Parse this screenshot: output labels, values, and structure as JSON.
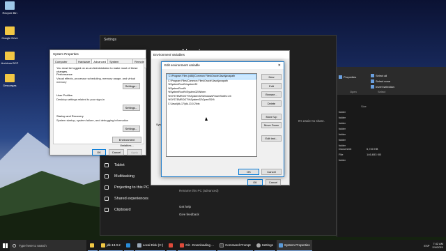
{
  "desktop": {
    "icons": [
      {
        "label": "Recycle Bin",
        "color": "#9ec7e8"
      },
      {
        "label": "Google Drive",
        "color": "#f2c744"
      },
      {
        "label": "Archivos BCP",
        "color": "#f2c744"
      },
      {
        "label": "Descargas",
        "color": "#f2c744"
      }
    ]
  },
  "settings": {
    "title": "Settings",
    "heading": "About",
    "side_note": "It's easier to share.",
    "nav": [
      {
        "label": "Tablet",
        "icon": "tablet-icon"
      },
      {
        "label": "Multitasking",
        "icon": "multitasking-icon"
      },
      {
        "label": "Projecting to this PC",
        "icon": "projecting-icon"
      },
      {
        "label": "Shared experiences",
        "icon": "shared-icon"
      },
      {
        "label": "Clipboard",
        "icon": "clipboard-icon"
      }
    ],
    "rename": "Rename this PC (advanced)",
    "help": "Get help",
    "feedback": "Give feedback"
  },
  "explorer": {
    "ribbon": {
      "properties": "Properties",
      "open": "Open",
      "select_all": "Select all",
      "select_none": "Select none",
      "invert": "Invert selection",
      "group_open": "Open",
      "group_select": "Select"
    },
    "size_header": "Size",
    "rows": [
      {
        "type": "folder",
        "size": ""
      },
      {
        "type": "folder",
        "size": ""
      },
      {
        "type": "folder",
        "size": ""
      },
      {
        "type": "folder",
        "size": ""
      },
      {
        "type": "folder",
        "size": ""
      },
      {
        "type": "folder",
        "size": ""
      },
      {
        "type": "folder",
        "size": ""
      },
      {
        "type": "Document",
        "size": "6,740 KB"
      },
      {
        "type": "File",
        "size": "146,653 KB"
      },
      {
        "type": "folder",
        "size": ""
      }
    ]
  },
  "sysprop": {
    "title": "System Properties",
    "tabs": [
      "Computer Name",
      "Hardware",
      "Advanced",
      "System Protection",
      "Remote"
    ],
    "active_tab": "Advanced",
    "note": "You must be logged on as an Administrator to make most of these changes.",
    "sections": [
      {
        "heading": "Performance",
        "desc": "Visual effects, processor scheduling, memory usage, and virtual memory",
        "button": "Settings..."
      },
      {
        "heading": "User Profiles",
        "desc": "Desktop settings related to your sign-in",
        "button": "Settings..."
      },
      {
        "heading": "Startup and Recovery",
        "desc": "System startup, system failure, and debugging information",
        "button": "Settings..."
      }
    ],
    "env_button": "Environment Variables...",
    "ok": "OK",
    "cancel": "Cancel",
    "apply": "Apply"
  },
  "envvars": {
    "title": "Environment Variables",
    "frag_a": "Syst",
    "ok": "OK",
    "cancel": "Cancel"
  },
  "editenv": {
    "title": "Edit environment variable",
    "close": "✕",
    "items": [
      "C:\\Program Files (x86)\\Common Files\\Oracle\\Java\\javapath",
      "C:\\Program Files\\Common Files\\Oracle\\Java\\javapath",
      "%SystemRoot%\\system32",
      "%SystemRoot%",
      "%SystemRoot%\\System32\\Wbem",
      "%SYSTEMROOT%\\System32\\WindowsPowerShell\\v1.0\\",
      "%SYSTEMROOT%\\System32\\OpenSSH\\",
      "C:\\Java\\jdk-17\\jdk-13.0.2\\bin"
    ],
    "buttons": [
      "New",
      "Edit",
      "Browse...",
      "Delete",
      "Move Up",
      "Move Down",
      "Edit text..."
    ],
    "ok": "OK",
    "cancel": "Cancel"
  },
  "taskbar": {
    "search": "Type here to search",
    "items": [
      {
        "label": "",
        "icon": "file-explorer-icon",
        "color": "#f2c744"
      },
      {
        "label": "jdk-13.0.2",
        "icon": "folder-icon",
        "color": "#f2c744"
      },
      {
        "label": "",
        "icon": "edge-icon",
        "color": "#2a8dd8"
      },
      {
        "label": "Local Disk (C:)",
        "icon": "disk-icon",
        "color": "#9aa8b8"
      },
      {
        "label": "",
        "icon": "chrome-icon",
        "color": "#e04a3a"
      },
      {
        "label": "Git - Downloading ...",
        "icon": "chrome-icon",
        "color": "#e04a3a"
      },
      {
        "label": "Command Prompt",
        "icon": "cmd-icon",
        "color": "#444"
      },
      {
        "label": "Settings",
        "icon": "gear-icon",
        "color": "#aaa"
      },
      {
        "label": "System Properties",
        "icon": "system-icon",
        "color": "#5a9ad8"
      }
    ],
    "language": "ESP",
    "time": "7:42 AM",
    "date": "2/4/2021"
  }
}
